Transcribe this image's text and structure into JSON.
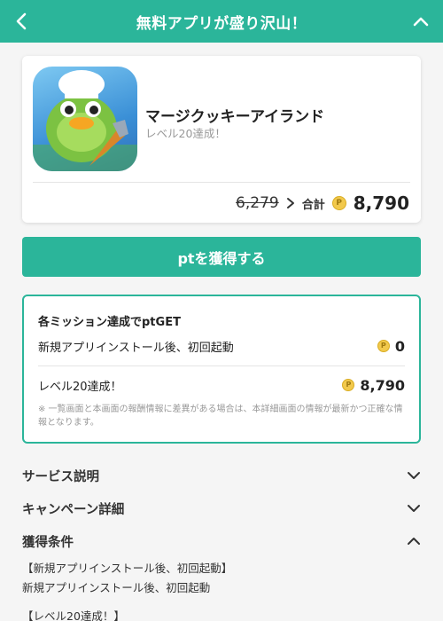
{
  "header": {
    "title": "無料アプリが盛り沢山！"
  },
  "app": {
    "name": "マージクッキーアイランド",
    "subtitle": "レベル20達成！",
    "old_price": "6,279",
    "total_label": "合計",
    "coin_symbol": "P",
    "total_price": "8,790"
  },
  "get_button": {
    "label": "ptを獲得する"
  },
  "missions": {
    "title": "各ミッション達成でptGET",
    "items": [
      {
        "label": "新規アプリインストール後、初回起動",
        "points": "0"
      },
      {
        "label": "レベル20達成！",
        "points": "8,790"
      }
    ],
    "note": "※ 一覧画面と本画面の報酬情報に差異がある場合は、本詳細画面の情報が最新かつ正確な情報となります。"
  },
  "accordions": [
    {
      "label": "サービス説明",
      "expanded": false
    },
    {
      "label": "キャンペーン詳細",
      "expanded": false
    },
    {
      "label": "獲得条件",
      "expanded": true
    }
  ],
  "conditions": {
    "lines": [
      "【新規アプリインストール後、初回起動】",
      "新規アプリインストール後、初回起動",
      "【レベル20達成！】"
    ]
  },
  "colors": {
    "accent": "#2bb59a",
    "coin": "#f2c94c",
    "background": "#f5f5f5"
  },
  "icons": {
    "back": "chevron-left-icon",
    "collapse": "chevron-up-icon",
    "coin": "coin-icon"
  }
}
